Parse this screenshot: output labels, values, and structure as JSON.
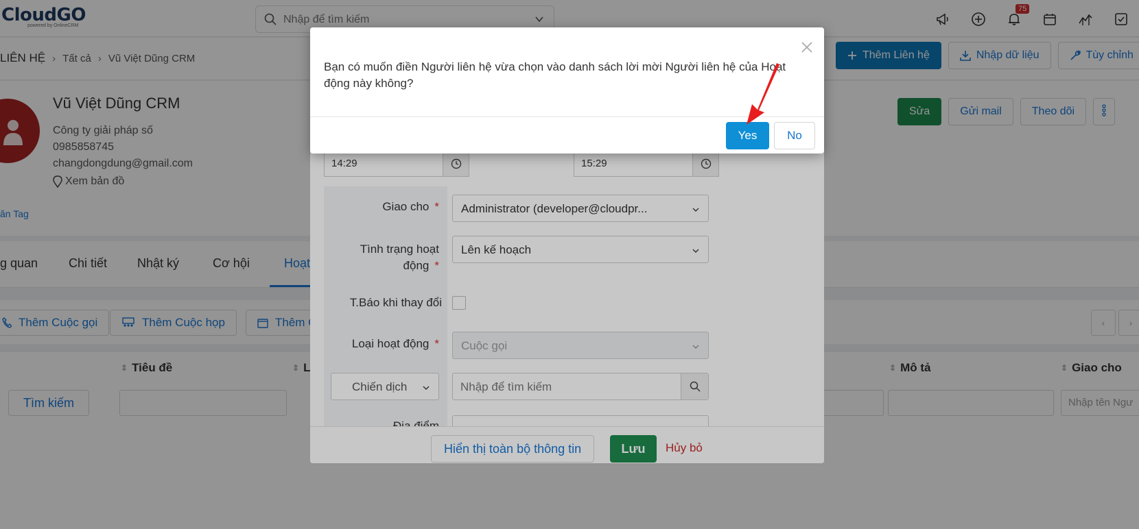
{
  "app": {
    "logo_text": "CloudGO",
    "logo_sub": "powered by OnlineCRM",
    "search_placeholder": "Nhập để tìm kiếm",
    "notification_count": "75",
    "icons": [
      "megaphone-icon",
      "plus-circle-icon",
      "bell-icon",
      "calendar-icon",
      "chart-icon",
      "checkbox-icon"
    ]
  },
  "breadcrumb": {
    "module": "LIÊN HỆ",
    "all": "Tất cả",
    "record": "Vũ Việt Dũng CRM"
  },
  "header_actions": {
    "add_contact": "Thêm Liên hệ",
    "import": "Nhập dữ liệu",
    "customize": "Tùy chỉnh"
  },
  "profile": {
    "name": "Vũ Việt Dũng CRM",
    "company": "Công ty giải pháp số",
    "phone": "0985858745",
    "email": "changdongdung@gmail.com",
    "map_link": "Xem bản đồ",
    "tag_link": "ăn Tag",
    "edit_button": "Sửa",
    "send_mail_button": "Gửi mail",
    "follow_button": "Theo dõi"
  },
  "tabs": [
    "g quan",
    "Chi tiết",
    "Nhật ký",
    "Cơ hội",
    "Hoạt"
  ],
  "activity_actions": {
    "add_call": "Thêm Cuộc gọi",
    "add_meeting": "Thêm Cuộc họp",
    "add_other": "Thêm C"
  },
  "table": {
    "columns": [
      "Tiêu đề",
      "L",
      "Mô tả",
      "Giao cho"
    ],
    "search_button": "Tìm kiếm",
    "assignee_placeholder": "Nhập tên Ngư"
  },
  "edit_form": {
    "start_time": "14:29",
    "end_time": "15:29",
    "assigned_label": "Giao cho",
    "assigned_value": "Administrator (developer@cloudpr...",
    "status_label": "Tình trạng hoạt động",
    "status_value": "Lên kế hoạch",
    "notify_label": "T.Báo khi thay đổi",
    "type_label": "Loại hoạt động",
    "type_value": "Cuộc gọi",
    "campaign_select": "Chiến dịch",
    "campaign_placeholder": "Nhập để tìm kiếm",
    "location_label": "Địa điểm",
    "show_all_button": "Hiển thị toàn bộ thông tin",
    "save_button": "Lưu",
    "cancel_link": "Hủy bỏ",
    "required_mark": "*"
  },
  "confirm_dialog": {
    "message": "Bạn có muốn điền Người liên hệ vừa chọn vào danh sách lời mời Người liên hệ của Hoạt động này không?",
    "yes_button": "Yes",
    "no_button": "No"
  },
  "colors": {
    "primary": "#0f78b8",
    "yes": "#0f8fd6",
    "green": "#1e8a4f",
    "link": "#1976d2",
    "danger": "#c62828",
    "arrow": "#e81e1e"
  }
}
